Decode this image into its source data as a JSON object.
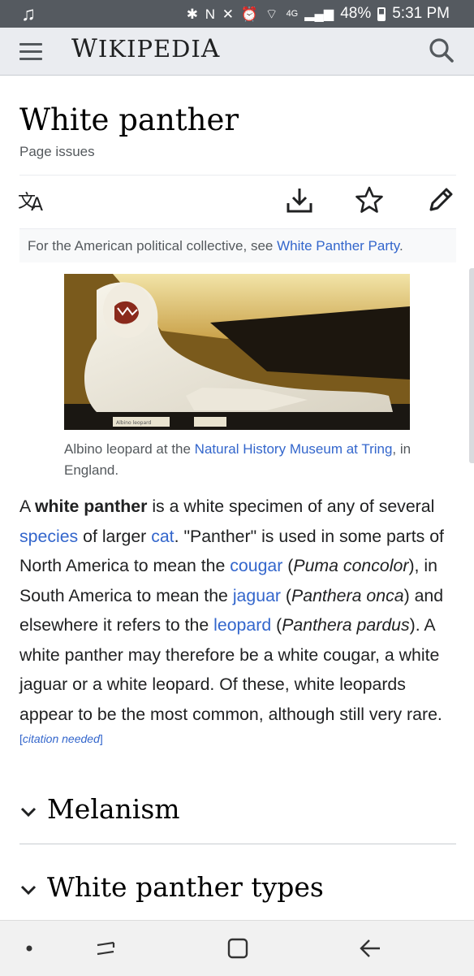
{
  "status_bar": {
    "battery": "48%",
    "time": "5:31 PM",
    "icons": [
      "music-note-icon",
      "bluetooth-icon",
      "nfc-icon",
      "mute-icon",
      "alarm-icon",
      "wifi-icon",
      "4g-signal-icon",
      "battery-icon"
    ],
    "network": "4G"
  },
  "header": {
    "wordmark_first": "W",
    "wordmark_mid": "IKIPEDI",
    "wordmark_last": "A"
  },
  "article": {
    "title": "White panther",
    "page_issues": "Page issues",
    "hatnote_prefix": "For the American political collective, see ",
    "hatnote_link": "White Panther Party",
    "hatnote_suffix": ".",
    "image_placard_text": "Albino leopard",
    "caption_prefix": "Albino leopard at the ",
    "caption_link": "Natural History Museum at Tring",
    "caption_suffix": ", in England.",
    "body": {
      "t1": "A ",
      "b1": "white panther",
      "t2": " is a white specimen of any of several ",
      "l_species": "species",
      "t3": " of larger ",
      "l_cat": "cat",
      "t4": ". \"Panther\" is used in some parts of North America to mean the ",
      "l_cougar": "cougar",
      "t5": " (",
      "i_puma": "Puma concolor",
      "t6": "), in South America to mean the ",
      "l_jaguar": "jaguar",
      "t7": " (",
      "i_onca": "Panthera onca",
      "t8": ") and elsewhere it refers to the ",
      "l_leopard": "leopard",
      "t9": " (",
      "i_pardus": "Panthera pardus",
      "t10": "). A white panther may therefore be a white cougar, a white jaguar or a white leopard. Of these, white leopards appear to be the most common, although still very rare.",
      "cite_open": "[",
      "cite_text": "citation needed",
      "cite_close": "]"
    },
    "sections": [
      "Melanism",
      "White panther types"
    ]
  },
  "colors": {
    "link": "#3366cc",
    "header_bg": "#eaecf0",
    "statusbar_bg": "#555a60"
  }
}
